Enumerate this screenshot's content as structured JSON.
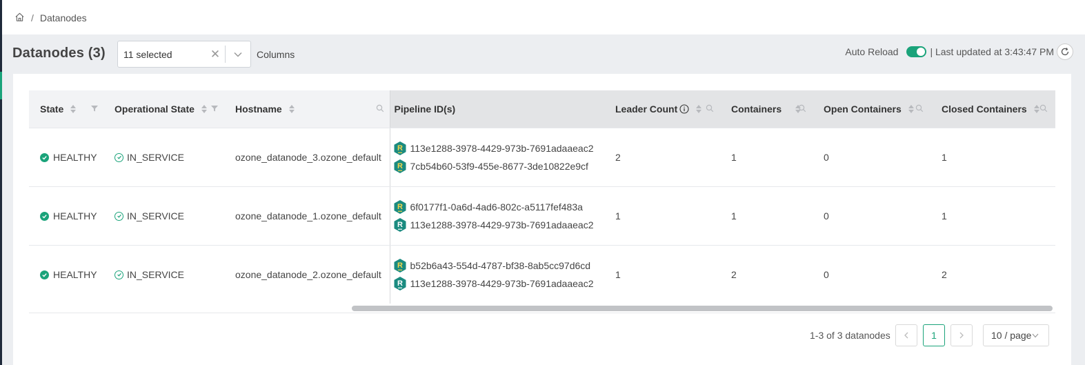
{
  "breadcrumb": {
    "home_icon": "home-icon",
    "separator": "/",
    "current": "Datanodes"
  },
  "header": {
    "title": "Datanodes (3)",
    "columns_select": {
      "value": "11 selected",
      "label": "Columns"
    },
    "auto_reload": {
      "label": "Auto Reload",
      "enabled": true,
      "last_updated": "| Last updated at 3:43:47 PM"
    }
  },
  "table": {
    "columns": [
      {
        "label": "State"
      },
      {
        "label": "Operational State"
      },
      {
        "label": "Hostname"
      },
      {
        "label": "Pipeline ID(s)"
      },
      {
        "label": "Leader Count"
      },
      {
        "label": "Containers"
      },
      {
        "label": "Open Containers"
      },
      {
        "label": "Closed Containers"
      }
    ],
    "rows": [
      {
        "state": "HEALTHY",
        "op_state": "IN_SERVICE",
        "hostname": "ozone_datanode_3.ozone_default",
        "pipelines": [
          {
            "id": "113e1288-3978-4429-973b-7691adaaeac2",
            "role": "leader"
          },
          {
            "id": "7cb54b60-53f9-455e-8677-3de10822e9cf",
            "role": "leader"
          }
        ],
        "leader_count": "2",
        "containers": "1",
        "open_containers": "0",
        "closed_containers": "1"
      },
      {
        "state": "HEALTHY",
        "op_state": "IN_SERVICE",
        "hostname": "ozone_datanode_1.ozone_default",
        "pipelines": [
          {
            "id": "6f0177f1-0a6d-4ad6-802c-a5117fef483a",
            "role": "leader"
          },
          {
            "id": "113e1288-3978-4429-973b-7691adaaeac2",
            "role": "follower"
          }
        ],
        "leader_count": "1",
        "containers": "1",
        "open_containers": "0",
        "closed_containers": "1"
      },
      {
        "state": "HEALTHY",
        "op_state": "IN_SERVICE",
        "hostname": "ozone_datanode_2.ozone_default",
        "pipelines": [
          {
            "id": "b52b6a43-554d-4787-bf38-8ab5cc97d6cd",
            "role": "leader"
          },
          {
            "id": "113e1288-3978-4429-973b-7691adaaeac2",
            "role": "follower"
          }
        ],
        "leader_count": "1",
        "containers": "2",
        "open_containers": "0",
        "closed_containers": "2"
      }
    ]
  },
  "pagination": {
    "summary": "1-3 of 3 datanodes",
    "current_page": "1",
    "page_size": "10 / page"
  },
  "colors": {
    "accent": "#1aa37a",
    "pipeline_badge": "#1a8b80",
    "leader_letter": "#f5d44b",
    "follower_letter": "#ffffff"
  }
}
